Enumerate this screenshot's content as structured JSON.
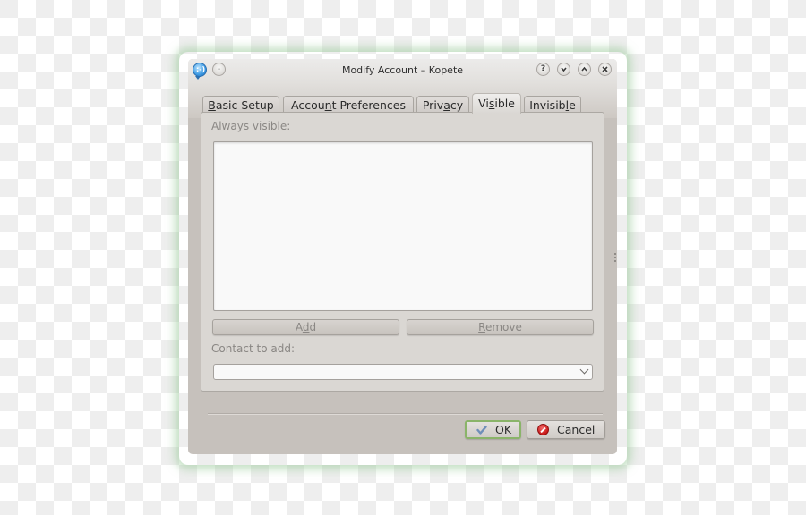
{
  "window": {
    "title": "Modify Account – Kopete",
    "app_icon": "kopete-icon",
    "controls": {
      "menu_icon": "window-menu-icon",
      "help_glyph": "?",
      "minimize_glyph": "⌄",
      "maximize_glyph": "⌃",
      "close_glyph": "✕"
    }
  },
  "tabs": [
    {
      "pre": "",
      "mn": "B",
      "post": "asic Setup",
      "active": false
    },
    {
      "pre": "Accou",
      "mn": "n",
      "post": "t Preferences",
      "active": false
    },
    {
      "pre": "Priv",
      "mn": "a",
      "post": "cy",
      "active": false
    },
    {
      "pre": "Vi",
      "mn": "s",
      "post": "ible",
      "active": true
    },
    {
      "pre": "Invisib",
      "mn": "l",
      "post": "e",
      "active": false
    }
  ],
  "visible_tab": {
    "always_visible_label": "Always visible:",
    "always_visible_items": [],
    "add_button": {
      "pre": "A",
      "mn": "d",
      "post": "d",
      "enabled": false
    },
    "remove_button": {
      "pre": "",
      "mn": "R",
      "post": "emove",
      "enabled": false
    },
    "contact_to_add_label": "Contact to add:",
    "contact_to_add_value": ""
  },
  "dialog_buttons": {
    "ok": {
      "pre": "",
      "mn": "O",
      "post": "K",
      "icon": "checkmark-icon"
    },
    "cancel": {
      "pre": "",
      "mn": "C",
      "post": "ancel",
      "icon": "cancel-icon"
    }
  },
  "colors": {
    "window_bg": "#c6c1bc",
    "panel_bg": "#dad7d3",
    "focus_green": "#8ab469",
    "disabled_text": "#8a8784"
  }
}
